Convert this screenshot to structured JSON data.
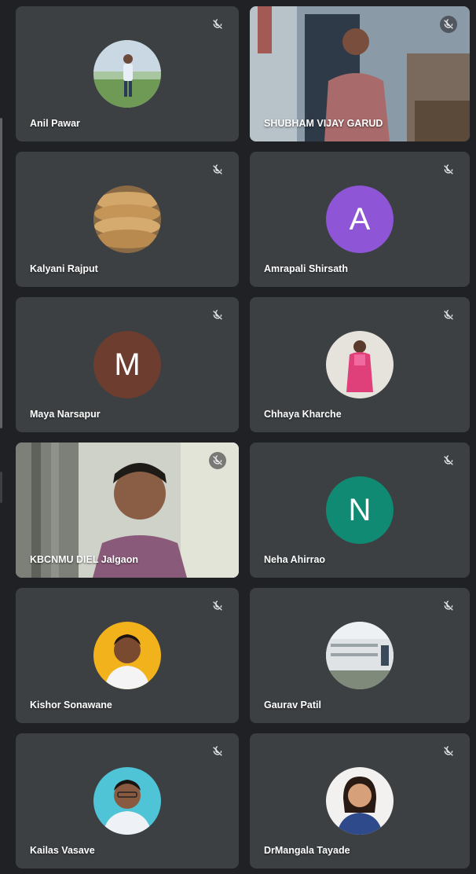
{
  "participants": [
    {
      "name": "Anil Pawar",
      "avatar_type": "photo",
      "avatar_desc": "person standing outdoors"
    },
    {
      "name": "SHUBHAM VIJAY GARUD",
      "avatar_type": "video"
    },
    {
      "name": "Kalyani Rajput",
      "avatar_type": "photo",
      "avatar_desc": "stack of bread"
    },
    {
      "name": "Amrapali Shirsath",
      "avatar_type": "letter",
      "letter": "A",
      "color": "#8e55d6"
    },
    {
      "name": "Maya Narsapur",
      "avatar_type": "letter",
      "letter": "M",
      "color": "#6d3d2f"
    },
    {
      "name": "Chhaya Kharche",
      "avatar_type": "photo",
      "avatar_desc": "woman in pink saree"
    },
    {
      "name": "KBCNMU DIEL Jalgaon",
      "avatar_type": "video"
    },
    {
      "name": "Neha Ahirrao",
      "avatar_type": "letter",
      "letter": "N",
      "color": "#108a72"
    },
    {
      "name": "Kishor Sonawane",
      "avatar_type": "photo",
      "avatar_desc": "man portrait yellow background"
    },
    {
      "name": "Gaurav Patil",
      "avatar_type": "photo",
      "avatar_desc": "white building"
    },
    {
      "name": "Kailas Vasave",
      "avatar_type": "photo",
      "avatar_desc": "man portrait blue background"
    },
    {
      "name": "DrMangala Tayade",
      "avatar_type": "photo",
      "avatar_desc": "woman portrait"
    }
  ],
  "icons": {
    "muted": "mic-off-icon"
  }
}
